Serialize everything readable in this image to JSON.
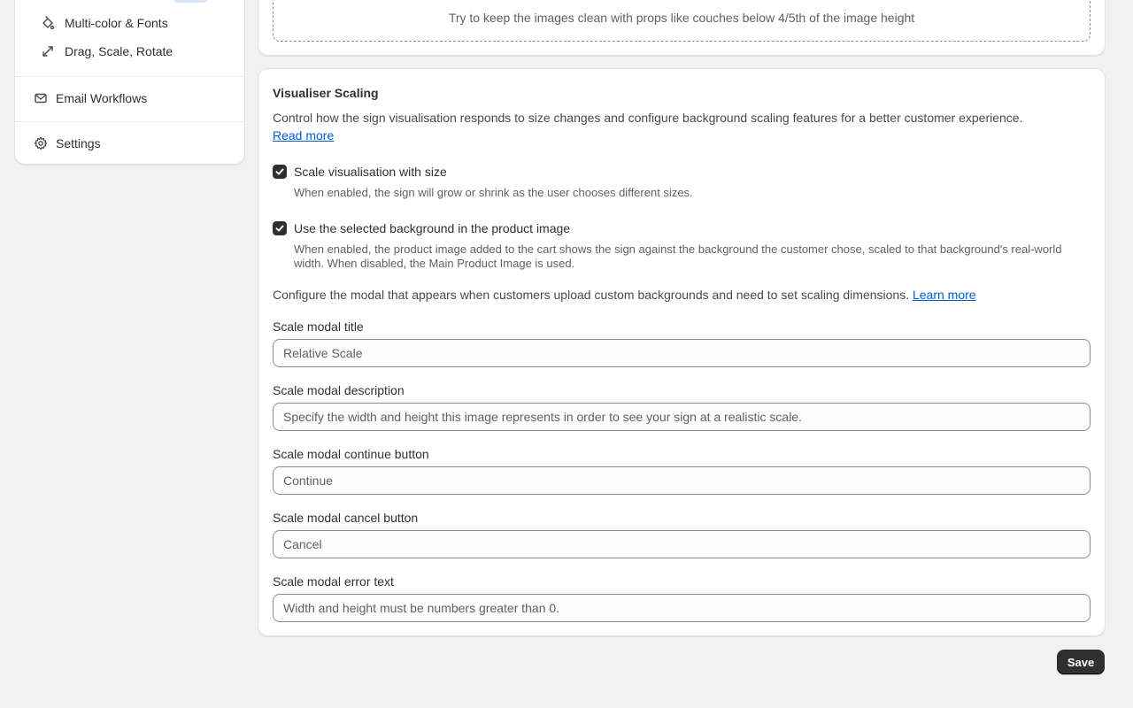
{
  "sidebar": {
    "sub_items": [
      {
        "label": "Multi-color & Fonts",
        "icon": "paint-brush-icon"
      },
      {
        "label": "Drag, Scale, Rotate",
        "icon": "resize-arrows-icon"
      }
    ],
    "main_items": [
      {
        "label": "Email Workflows",
        "icon": "envelope-icon"
      },
      {
        "label": "Settings",
        "icon": "gear-icon"
      }
    ]
  },
  "top_card": {
    "dropzone_hint": "Try to keep the images clean with props like couches below 4/5th of the image height"
  },
  "scaling": {
    "title": "Visualiser Scaling",
    "description": "Control how the sign visualisation responds to size changes and configure background scaling features for a better customer experience.",
    "read_more": "Read more",
    "options": [
      {
        "label": "Scale visualisation with size",
        "help": "When enabled, the sign will grow or shrink as the user chooses different sizes.",
        "checked": true
      },
      {
        "label": "Use the selected background in the product image",
        "help": "When enabled, the product image added to the cart shows the sign against the background the customer chose, scaled to that background's real-world width. When disabled, the Main Product Image is used.",
        "checked": true
      }
    ],
    "modal_config_text": "Configure the modal that appears when customers upload custom backgrounds and need to set scaling dimensions.",
    "learn_more": "Learn more",
    "fields": [
      {
        "label": "Scale modal title",
        "placeholder": "Relative Scale"
      },
      {
        "label": "Scale modal description",
        "placeholder": "Specify the width and height this image represents in order to see your sign at a realistic scale."
      },
      {
        "label": "Scale modal continue button",
        "placeholder": "Continue"
      },
      {
        "label": "Scale modal cancel button",
        "placeholder": "Cancel"
      },
      {
        "label": "Scale modal error text",
        "placeholder": "Width and height must be numbers greater than 0."
      }
    ]
  },
  "actions": {
    "save_label": "Save"
  },
  "colors": {
    "background": "#f1f1f1",
    "card": "#ffffff",
    "link": "#005bd3",
    "primary_button": "#303030"
  }
}
